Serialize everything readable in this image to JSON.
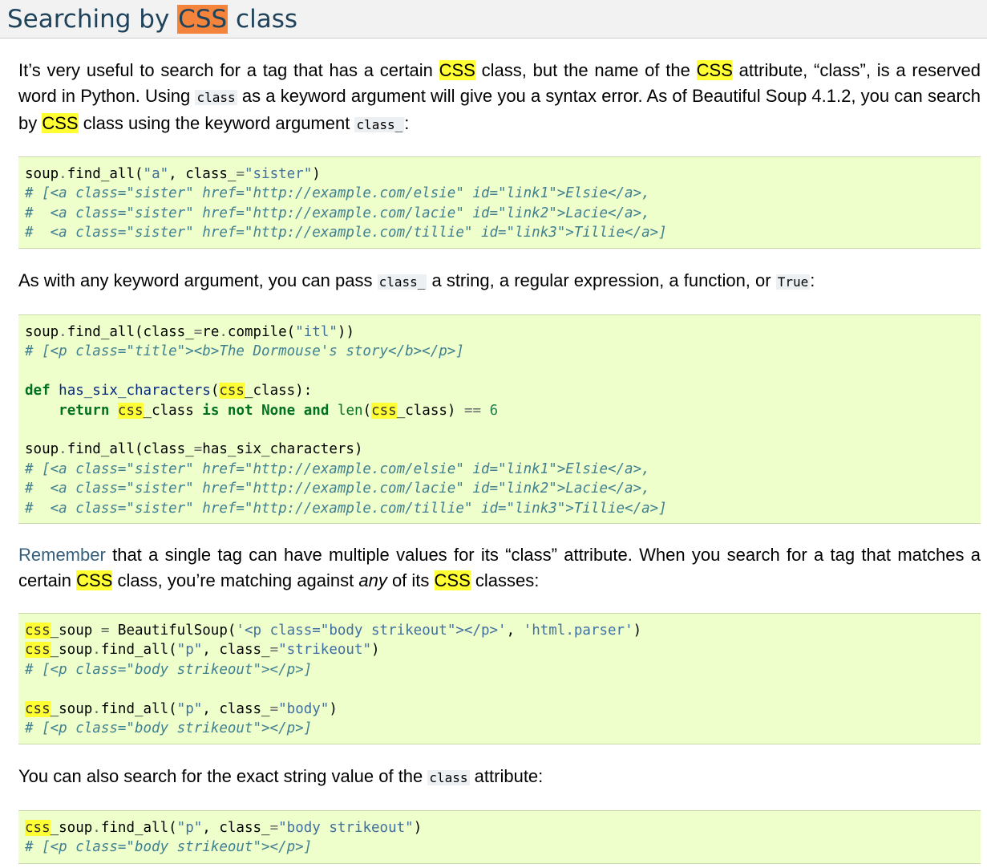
{
  "heading": {
    "prefix": "Searching by ",
    "highlight": "CSS",
    "suffix": " class"
  },
  "p1": {
    "t1": "It’s very useful to search for a tag that has a certain ",
    "css1": "CSS",
    "t2": " class, but the name of the ",
    "css2": "CSS",
    "t3": " attribute, “class”, is a reserved word in Python. Using ",
    "code1": "class",
    "t4": " as a keyword argument will give you a syntax error. As of Beautiful Soup 4.1.2, you can search by ",
    "css3": "CSS",
    "t5": " class using the keyword argument ",
    "code2": "class_",
    "t6": ":"
  },
  "code1": {
    "l1_a": "soup",
    "l1_b": ".",
    "l1_c": "find_all(",
    "l1_s1": "\"a\"",
    "l1_d": ", class_",
    "l1_eq": "=",
    "l1_s2": "\"sister\"",
    "l1_e": ")",
    "l2": "# [<a class=\"sister\" href=\"http://example.com/elsie\" id=\"link1\">Elsie</a>,",
    "l3": "#  <a class=\"sister\" href=\"http://example.com/lacie\" id=\"link2\">Lacie</a>,",
    "l4": "#  <a class=\"sister\" href=\"http://example.com/tillie\" id=\"link3\">Tillie</a>]"
  },
  "p2": {
    "t1": "As with any keyword argument, you can pass ",
    "code1": "class_",
    "t2": " a string, a regular expression, a function, or ",
    "code2": "True",
    "t3": ":"
  },
  "code2": {
    "l1_a": "soup",
    "l1_b": ".",
    "l1_c": "find_all(class_",
    "l1_eq": "=",
    "l1_d": "re",
    "l1_dot": ".",
    "l1_e": "compile(",
    "l1_s": "\"itl\"",
    "l1_f": "))",
    "l2": "# [<p class=\"title\"><b>The Dormouse's story</b></p>]",
    "l4_def": "def",
    "l4_fn": "has_six_characters",
    "l4_p1": "(",
    "l4_css": "css",
    "l4_rest": "_class):",
    "l5_ret": "return",
    "l5_css": "css",
    "l5_cls": "_class ",
    "l5_isnot": "is not",
    "l5_none": "None",
    "l5_and": "and",
    "l5_len": "len",
    "l5_p": "(",
    "l5_css2": "css",
    "l5_cls2": "_class) ",
    "l5_eq": "==",
    "l5_num": "6",
    "l7_a": "soup",
    "l7_b": ".",
    "l7_c": "find_all(class_",
    "l7_eq": "=",
    "l7_d": "has_six_characters)",
    "l8": "# [<a class=\"sister\" href=\"http://example.com/elsie\" id=\"link1\">Elsie</a>,",
    "l9": "#  <a class=\"sister\" href=\"http://example.com/lacie\" id=\"link2\">Lacie</a>,",
    "l10": "#  <a class=\"sister\" href=\"http://example.com/tillie\" id=\"link3\">Tillie</a>]"
  },
  "p3": {
    "link": "Remember",
    "t1": " that a single tag can have multiple values for its “class” attribute. When you search for a tag that matches a certain ",
    "css1": "CSS",
    "t2": " class, you’re matching against ",
    "em": "any",
    "t3": " of its ",
    "css2": "CSS",
    "t4": " classes:"
  },
  "code3": {
    "l1_css": "css",
    "l1_a": "_soup ",
    "l1_eq": "=",
    "l1_b": " BeautifulSoup(",
    "l1_s1": "'<p class=\"body strikeout\"></p>'",
    "l1_c": ", ",
    "l1_s2": "'html.parser'",
    "l1_d": ")",
    "l2_css": "css",
    "l2_a": "_soup",
    "l2_dot": ".",
    "l2_b": "find_all(",
    "l2_s1": "\"p\"",
    "l2_c": ", class_",
    "l2_eq": "=",
    "l2_s2": "\"strikeout\"",
    "l2_d": ")",
    "l3": "# [<p class=\"body strikeout\"></p>]",
    "l5_css": "css",
    "l5_a": "_soup",
    "l5_dot": ".",
    "l5_b": "find_all(",
    "l5_s1": "\"p\"",
    "l5_c": ", class_",
    "l5_eq": "=",
    "l5_s2": "\"body\"",
    "l5_d": ")",
    "l6": "# [<p class=\"body strikeout\"></p>]"
  },
  "p4": {
    "t1": "You can also search for the exact string value of the ",
    "code": "class",
    "t2": " attribute:"
  },
  "code4": {
    "l1_css": "css",
    "l1_a": "_soup",
    "l1_dot": ".",
    "l1_b": "find_all(",
    "l1_s1": "\"p\"",
    "l1_c": ", class_",
    "l1_eq": "=",
    "l1_s2": "\"body strikeout\"",
    "l1_d": ")",
    "l2": "# [<p class=\"body strikeout\"></p>]"
  }
}
